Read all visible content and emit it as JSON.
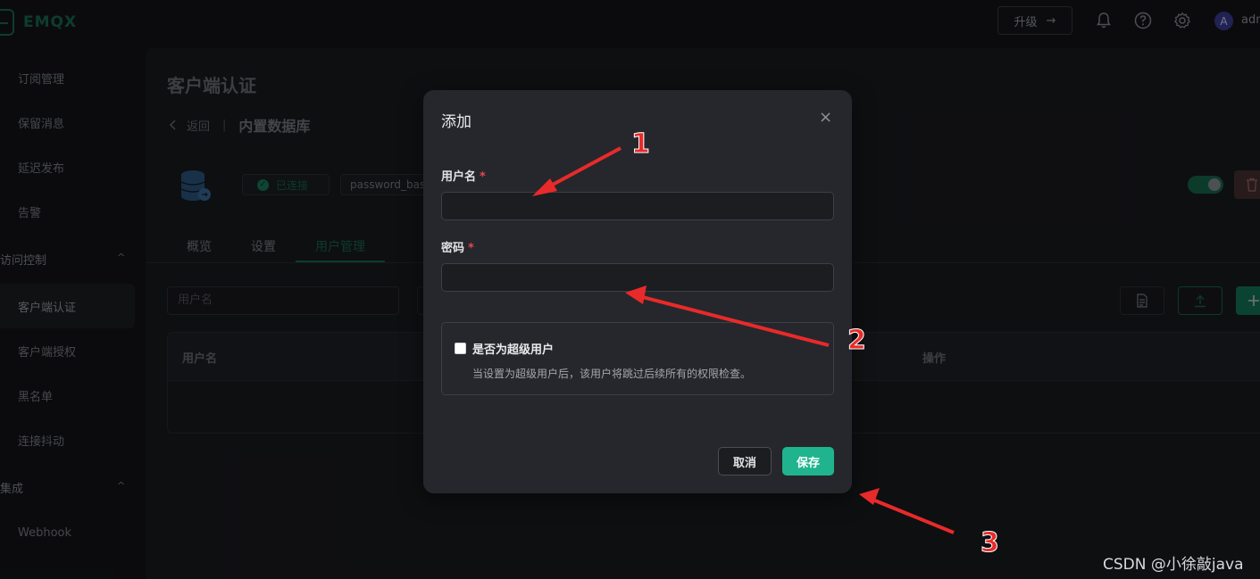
{
  "app": {
    "brand": "EMQX",
    "upgrade_label": "升级",
    "upgrade_arrow": "→",
    "avatar_letter": "A",
    "username": "adm"
  },
  "sidebar": {
    "items_top": [
      "订阅管理",
      "保留消息",
      "延迟发布",
      "告警"
    ],
    "group_access": "访问控制",
    "items_access": [
      "客户端认证",
      "客户端授权",
      "黑名单",
      "连接抖动"
    ],
    "group_integration": "集成",
    "items_integration": [
      "Webhook"
    ],
    "chevron": "^"
  },
  "main": {
    "page_title": "客户端认证",
    "back_label": "返回",
    "separator": "|",
    "db_name": "内置数据库",
    "status": "已连接",
    "mechanism": "password_based",
    "tabs": [
      "概览",
      "设置",
      "用户管理"
    ],
    "search_placeholder": "用户名",
    "table_headers": [
      "用户名",
      "操作"
    ]
  },
  "dialog": {
    "title": "添加",
    "close_glyph": "×",
    "username_label": "用户名",
    "password_label": "密码",
    "required_mark": "*",
    "username_value": "",
    "password_value": "",
    "superuser_label": "是否为超级用户",
    "superuser_desc": "当设置为超级用户后，该用户将跳过后续所有的权限检查。",
    "cancel_label": "取消",
    "save_label": "保存"
  },
  "annotations": {
    "n1": "1",
    "n2": "2",
    "n3": "3"
  },
  "watermark": "CSDN @小徐敲java",
  "colors": {
    "accent": "#1fb48d",
    "arrow": "#e82a2a",
    "dialog_bg": "#25272c",
    "page_bg": "#141518"
  },
  "icons": [
    "bell-icon",
    "help-icon",
    "gear-icon",
    "database-icon",
    "check-icon",
    "close-icon",
    "trash-icon",
    "file-icon",
    "upload-icon",
    "plus-icon",
    "back-chevron-icon"
  ]
}
